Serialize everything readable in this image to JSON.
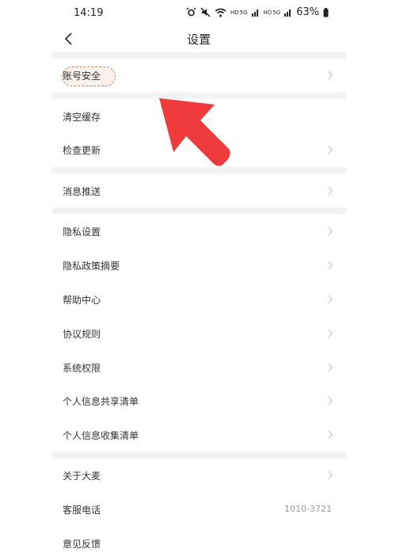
{
  "status_bar": {
    "time": "14:19",
    "hd1": "HD",
    "sig1": "5G",
    "hd2": "HD",
    "sig2": "5G",
    "battery": "63%",
    "icons": [
      "alarm-icon",
      "mute-icon",
      "wifi-icon",
      "signal-icon",
      "signal-icon",
      "battery-icon"
    ]
  },
  "header": {
    "title": "设置",
    "back_icon": "chevron-left-icon"
  },
  "settings": {
    "account_security": "账号安全",
    "clear_cache": "清空缓存",
    "check_update": "检查更新",
    "push": "消息推送",
    "privacy_settings": "隐私设置",
    "privacy_summary": "隐私政策摘要",
    "help": "帮助中心",
    "agreements": "协议规则",
    "permissions": "系统权限",
    "sharing_list": "个人信息共享清单",
    "collection_list": "个人信息收集清单",
    "about": "关于大麦",
    "service_phone": "客服电话",
    "service_phone_number": "1010-3721",
    "feedback": "意见反馈"
  },
  "colors": {
    "annotation_arrow": "#ef3b3b",
    "highlight_border": "#b98a72",
    "section_gap": "#f2f2f4",
    "chevron": "#c8c8c8"
  }
}
